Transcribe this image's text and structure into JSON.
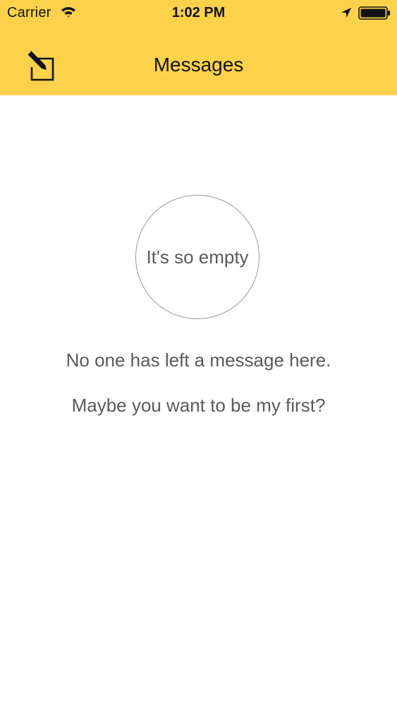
{
  "status_bar": {
    "carrier": "Carrier",
    "time": "1:02 PM",
    "icons": [
      "wifi-icon",
      "location-arrow-icon",
      "battery-icon"
    ]
  },
  "nav": {
    "title": "Messages",
    "left_icon": "compose-icon"
  },
  "empty_state": {
    "circle_text": "It's so empty",
    "line1": "No one has left a message here.",
    "line2": "Maybe you want to be my first?"
  },
  "colors": {
    "header_background": "#fcd24a",
    "text_primary": "#111111",
    "text_secondary": "#5a5a5a",
    "circle_border": "#9b9b9b"
  }
}
